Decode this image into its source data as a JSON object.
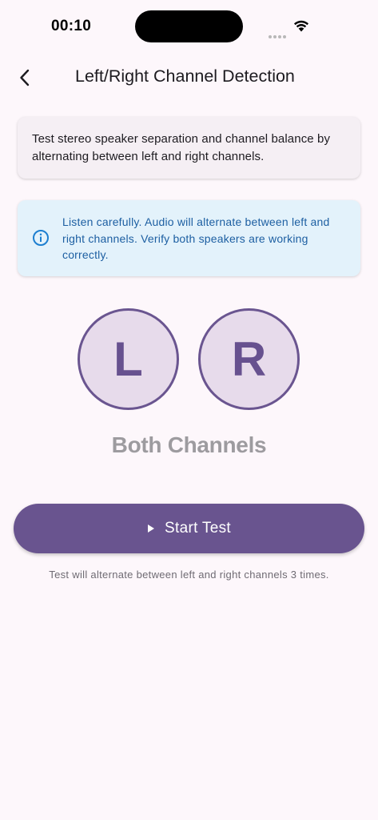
{
  "status_bar": {
    "time": "00:10"
  },
  "header": {
    "title": "Left/Right Channel Detection",
    "back_icon": "chevron-left-icon"
  },
  "description": {
    "text": "Test stereo speaker separation and channel balance by alternating between left and right channels."
  },
  "info": {
    "icon": "info-icon",
    "text": "Listen carefully. Audio will alternate between left and right channels. Verify both speakers are working correctly."
  },
  "channels": {
    "left_label": "L",
    "right_label": "R",
    "status": "Both Channels"
  },
  "actions": {
    "start_label": "Start Test",
    "start_icon": "play-icon"
  },
  "footer": {
    "note": "Test will alternate between left and right channels 3 times."
  },
  "colors": {
    "background": "#fdf7fb",
    "primary": "#69548f",
    "circle_fill": "#e7dbeb",
    "info_bg": "#e3f2fb",
    "info_text": "#1d5fa2",
    "status_text": "#9d9b9f"
  }
}
